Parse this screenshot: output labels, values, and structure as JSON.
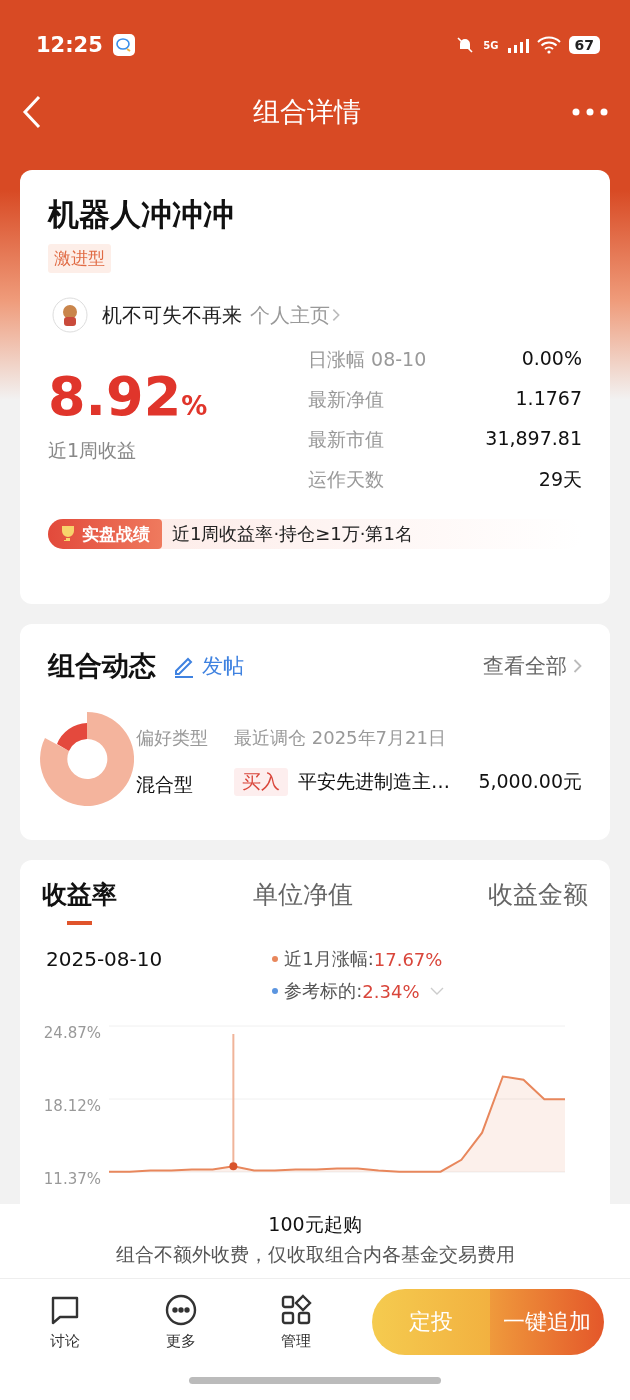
{
  "status_bar": {
    "time": "12:25",
    "network": "5G",
    "battery": "67"
  },
  "header": {
    "title": "组合详情"
  },
  "portfolio": {
    "name": "机器人冲冲冲",
    "risk_tag": "激进型",
    "manager": {
      "name": "机不可失不再来",
      "link": "个人主页"
    },
    "return": {
      "value": "8.92",
      "unit": "%",
      "label": "近1周收益"
    },
    "stats": [
      {
        "label": "日涨幅 08-10",
        "value": "0.00%"
      },
      {
        "label": "最新净值",
        "value": "1.1767"
      },
      {
        "label": "最新市值",
        "value": "31,897.81"
      },
      {
        "label": "运作天数",
        "value": "29天"
      }
    ],
    "ranking": {
      "badge": "实盘战绩",
      "text": "近1周收益率·持仓≥1万·第1名"
    }
  },
  "dynamics": {
    "title": "组合动态",
    "post_button": "发帖",
    "view_all": "查看全部",
    "preference": {
      "label": "偏好类型",
      "value": "混合型"
    },
    "latest": "最近调仓 2025年7月21日",
    "trade": {
      "action": "买入",
      "fund": "平安先进制造主…",
      "amount": "5,000.00元"
    }
  },
  "performance": {
    "tabs": [
      {
        "label": "收益率",
        "selected": true
      },
      {
        "label": "单位净值",
        "selected": false
      },
      {
        "label": "收益金额",
        "selected": false
      }
    ],
    "date": "2025-08-10",
    "legend": [
      {
        "label": "近1月涨幅:",
        "value": "17.67%",
        "color": "#e8875c",
        "dropdown": false
      },
      {
        "label": "参考标的:",
        "value": "2.34%",
        "color": "#5b95e0",
        "dropdown": true
      }
    ],
    "chart_data": {
      "type": "area",
      "ylim": [
        11.37,
        24.87
      ],
      "yticks": [
        {
          "value": 24.87,
          "label": "24.87%"
        },
        {
          "value": 18.12,
          "label": "18.12%"
        },
        {
          "value": 11.37,
          "label": "11.37%"
        }
      ],
      "series": [
        {
          "color": "#e8875c",
          "values": [
            11.4,
            11.4,
            11.5,
            11.5,
            11.6,
            11.6,
            11.9,
            11.5,
            11.5,
            11.6,
            11.6,
            11.7,
            11.7,
            11.5,
            11.4,
            11.4,
            11.4,
            12.5,
            15.0,
            20.2,
            19.9,
            18.1,
            18.1
          ]
        }
      ]
    }
  },
  "footer": {
    "min_purchase": "100元起购",
    "fee_note": "组合不额外收费，仅收取组合内各基金交易费用",
    "nav": [
      {
        "label": "讨论",
        "kind": "chat"
      },
      {
        "label": "更多",
        "kind": "more"
      },
      {
        "label": "管理",
        "kind": "manage"
      }
    ],
    "buttons": [
      {
        "label": "定投",
        "kind": "plan"
      },
      {
        "label": "一键追加",
        "kind": "add"
      }
    ]
  }
}
